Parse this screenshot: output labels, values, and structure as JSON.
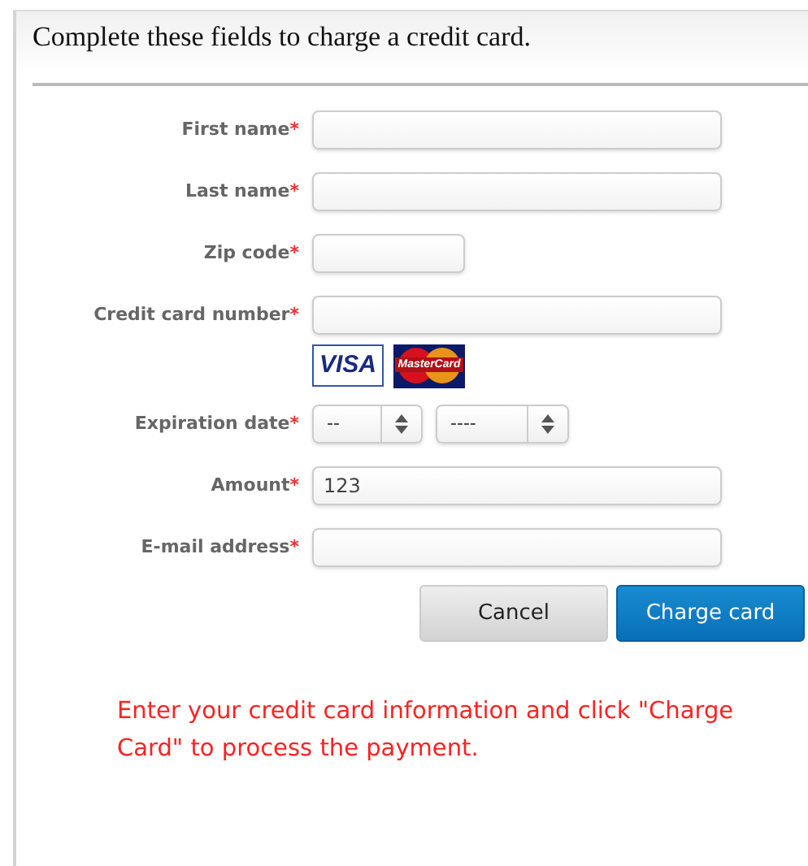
{
  "header": {
    "title": "Complete these fields to charge a credit card."
  },
  "fields": [
    {
      "kind": "text",
      "label": "First name",
      "required_mark": "*"
    },
    {
      "kind": "text",
      "label": "Last name",
      "required_mark": "*"
    },
    {
      "kind": "short",
      "label": "Zip code",
      "required_mark": "*"
    },
    {
      "kind": "text",
      "label": "Credit card number",
      "required_mark": "*",
      "card_logos": [
        {
          "kind": "visa",
          "text": "VISA"
        },
        {
          "kind": "mastercard",
          "text": "MasterCard"
        }
      ]
    },
    {
      "kind": "selects",
      "label": "Expiration date",
      "required_mark": "*",
      "selects": [
        "--",
        "----"
      ]
    },
    {
      "kind": "text",
      "label": "Amount",
      "required_mark": "*",
      "value": "123"
    },
    {
      "kind": "text",
      "label": "E-mail address",
      "required_mark": "*"
    }
  ],
  "buttons": [
    {
      "kind": "secondary",
      "label": "Cancel"
    },
    {
      "kind": "primary",
      "label": "Charge card"
    }
  ],
  "message": "Enter your credit card information and click \"Charge Card\" to process the payment."
}
